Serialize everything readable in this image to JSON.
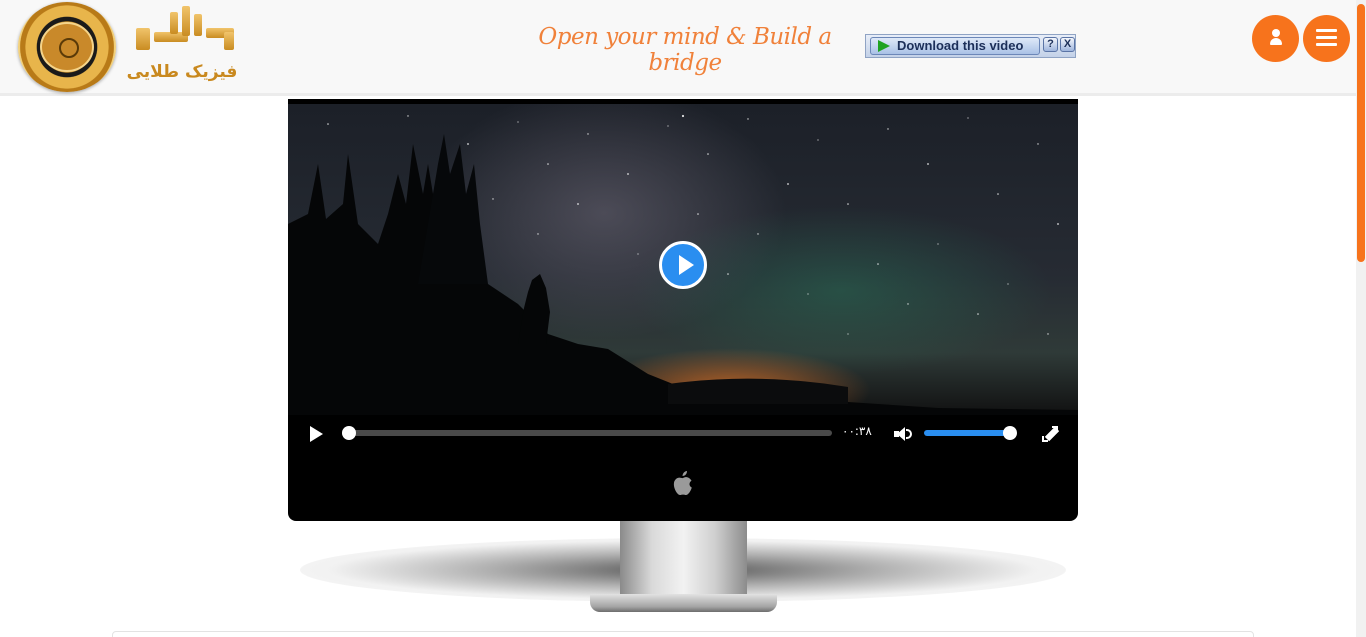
{
  "header": {
    "logo_word": "فیزیک طلایی",
    "slogan": "Open your mind & Build a bridge",
    "download_toolbar": {
      "button_label": "Download this video",
      "help_label": "?",
      "close_label": "X"
    },
    "user_icon": "user-icon",
    "menu_icon": "hamburger-menu-icon",
    "accent_color": "#f7731c"
  },
  "player": {
    "time_label": "۰۰:۳۸",
    "progress_fraction": 0.0,
    "volume_fraction": 0.92,
    "play_icon": "play-icon",
    "volume_icon": "volume-icon",
    "fullscreen_icon": "fullscreen-icon",
    "accent_color": "#2a8ef0"
  },
  "device": {
    "brand_icon": "apple-logo-icon"
  }
}
